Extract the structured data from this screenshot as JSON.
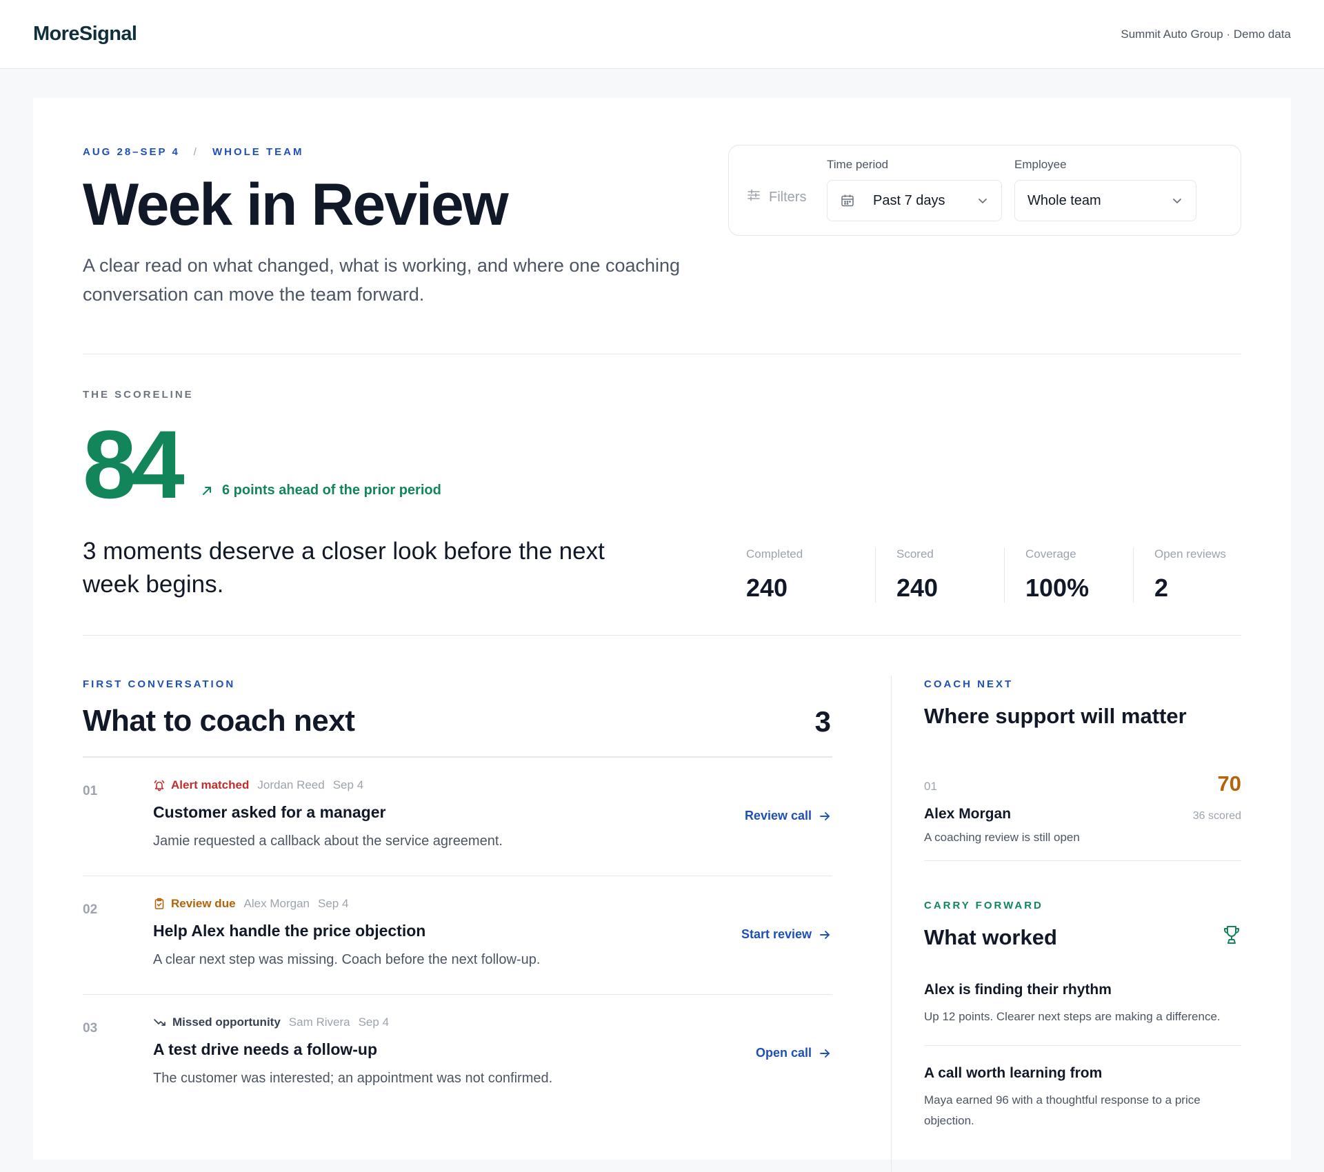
{
  "header": {
    "logo": "MoreSignal",
    "org_label": "Summit Auto Group · Demo data"
  },
  "hero": {
    "date_range": "AUG 28–SEP 4",
    "separator": "/",
    "scope": "WHOLE TEAM",
    "title": "Week in Review",
    "subtitle": "A clear read on what changed, what is working, and where one coaching conversation can move the team forward."
  },
  "filters": {
    "label": "Filters",
    "time_period": {
      "caption": "Time period",
      "value": "Past 7 days"
    },
    "employee": {
      "caption": "Employee",
      "value": "Whole team"
    }
  },
  "scoreline": {
    "eyebrow": "THE SCORELINE",
    "score": "84",
    "delta": "6 points ahead of the prior period",
    "summary": "3 moments deserve a closer look before the next week begins.",
    "stats": [
      {
        "label": "Completed",
        "value": "240"
      },
      {
        "label": "Scored",
        "value": "240"
      },
      {
        "label": "Coverage",
        "value": "100%"
      },
      {
        "label": "Open reviews",
        "value": "2"
      }
    ]
  },
  "coach_list": {
    "eyebrow": "FIRST CONVERSATION",
    "title": "What to coach next",
    "count": "3",
    "items": [
      {
        "num": "01",
        "tag": "Alert matched",
        "person": "Jordan Reed",
        "date": "Sep 4",
        "title": "Customer asked for a manager",
        "desc": "Jamie requested a callback about the service agreement.",
        "action": "Review call"
      },
      {
        "num": "02",
        "tag": "Review due",
        "person": "Alex Morgan",
        "date": "Sep 4",
        "title": "Help Alex handle the price objection",
        "desc": "A clear next step was missing. Coach before the next follow-up.",
        "action": "Start review"
      },
      {
        "num": "03",
        "tag": "Missed opportunity",
        "person": "Sam Rivera",
        "date": "Sep 4",
        "title": "A test drive needs a follow-up",
        "desc": "The customer was interested; an appointment was not confirmed.",
        "action": "Open call"
      }
    ]
  },
  "coach_next": {
    "eyebrow": "COACH NEXT",
    "title": "Where support will matter",
    "person": {
      "num": "01",
      "name": "Alex Morgan",
      "score": "70",
      "scored": "36 scored",
      "note": "A coaching review is still open"
    }
  },
  "carry_forward": {
    "eyebrow": "CARRY FORWARD",
    "title": "What worked",
    "wins": [
      {
        "title": "Alex is finding their rhythm",
        "desc": "Up 12 points. Clearer next steps are making a difference."
      },
      {
        "title": "A call worth learning from",
        "desc": "Maya earned 96 with a thoughtful response to a price objection."
      }
    ]
  },
  "colors": {
    "accent_blue": "#1e4fb8",
    "positive_green": "#12855a",
    "alert_red": "#c42b2b",
    "warning_amber": "#b4630a"
  },
  "icons": {
    "filters": "sliders-icon",
    "calendar": "calendar-icon",
    "dropdown": "chevron-down-icon",
    "delta": "arrow-up-right-icon",
    "alert": "bell-icon",
    "review": "clipboard-check-icon",
    "missed": "trend-down-icon",
    "action": "arrow-right-icon",
    "trophy": "trophy-icon"
  }
}
